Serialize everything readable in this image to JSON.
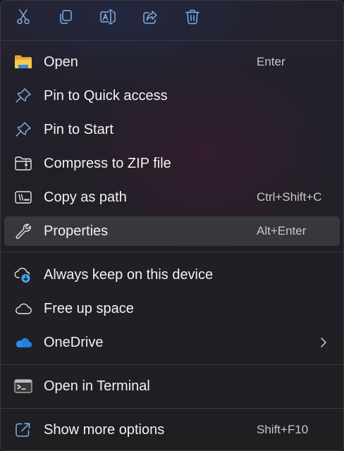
{
  "toolbar": {
    "icons": [
      "scissors-icon",
      "copy-icon",
      "rename-icon",
      "share-icon",
      "delete-icon"
    ],
    "icon_color": "#7fb0e8"
  },
  "items": [
    {
      "icon": "folder-icon",
      "label": "Open",
      "accel": "Enter"
    },
    {
      "icon": "pin-icon",
      "label": "Pin to Quick access",
      "accel": ""
    },
    {
      "icon": "pin-icon",
      "label": "Pin to Start",
      "accel": ""
    },
    {
      "icon": "zip-folder-icon",
      "label": "Compress to ZIP file",
      "accel": ""
    },
    {
      "icon": "copy-path-icon",
      "label": "Copy as path",
      "accel": "Ctrl+Shift+C"
    },
    {
      "icon": "wrench-icon",
      "label": "Properties",
      "accel": "Alt+Enter",
      "highlighted": true
    },
    {
      "icon": "cloud-download-icon",
      "label": "Always keep on this device",
      "accel": ""
    },
    {
      "icon": "cloud-outline-icon",
      "label": "Free up space",
      "accel": ""
    },
    {
      "icon": "onedrive-icon",
      "label": "OneDrive",
      "accel": "",
      "submenu": true
    },
    {
      "icon": "terminal-icon",
      "label": "Open in Terminal",
      "accel": ""
    },
    {
      "icon": "external-link-icon",
      "label": "Show more options",
      "accel": "Shift+F10"
    }
  ],
  "colors": {
    "accent": "#7fb0e8",
    "onedrive_blue": "#2b8ee6",
    "folder_yellow": "#f2c14e",
    "text": "#f2f2f2",
    "accel_text": "#c8c8c8",
    "highlight": "#38373c"
  }
}
